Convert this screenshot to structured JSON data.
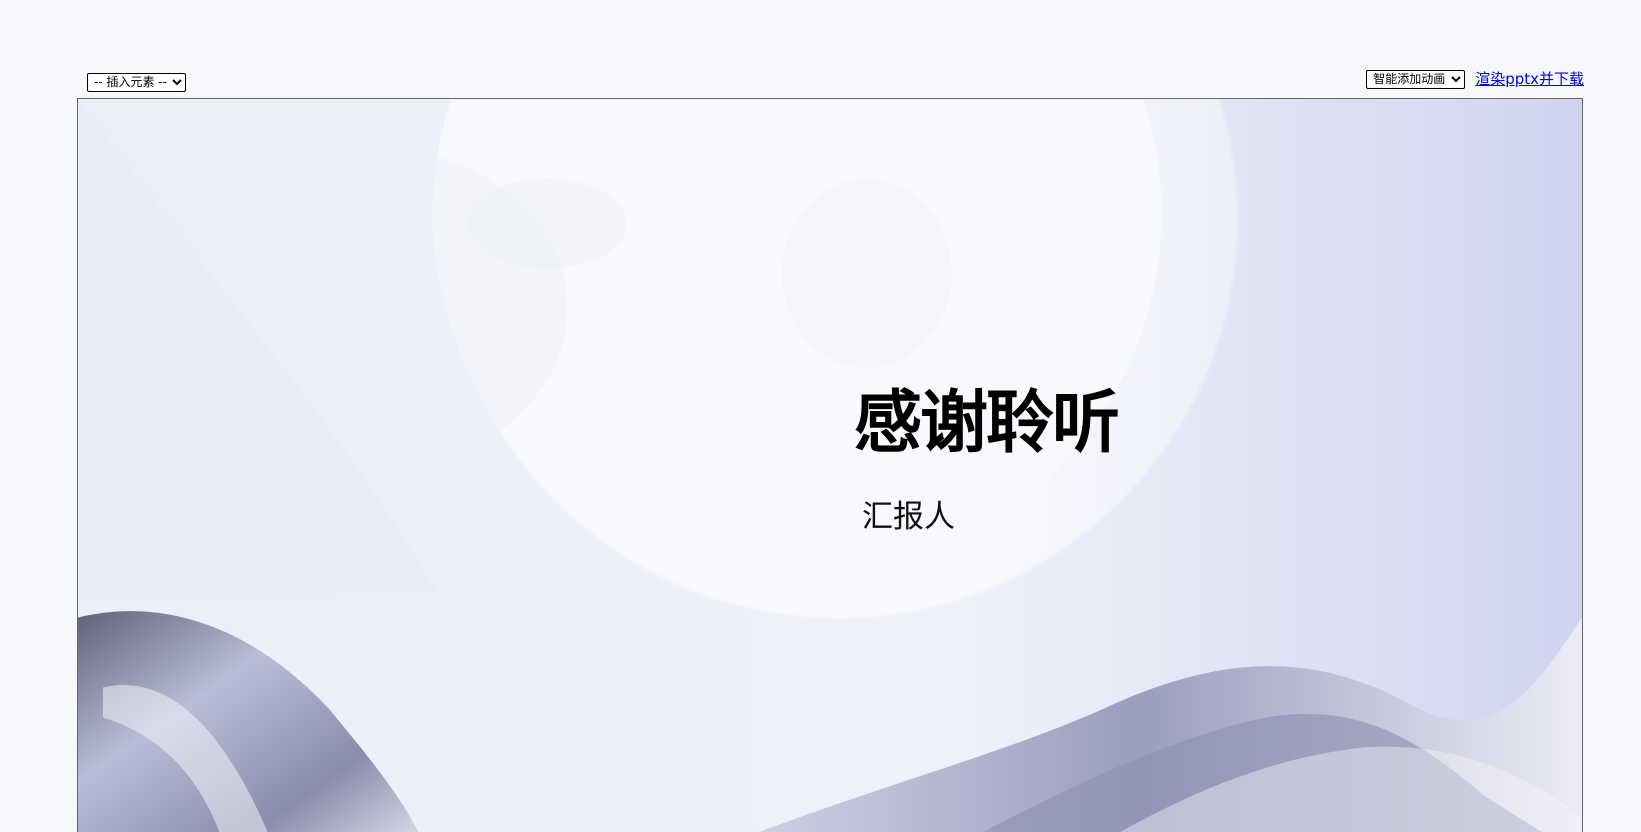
{
  "toolbar": {
    "insert_select_label": "-- 插入元素 --",
    "animation_select_label": "智能添加动画",
    "render_link_label": "渲染pptx并下载"
  },
  "slide": {
    "title": "感谢聆听",
    "subtitle": "汇报人"
  },
  "colors": {
    "page_background": "#f7f8fc",
    "link": "#0000ee",
    "slide_accent": "#8c8db6"
  },
  "icons": {
    "select_arrow": "chevron-down-icon"
  }
}
